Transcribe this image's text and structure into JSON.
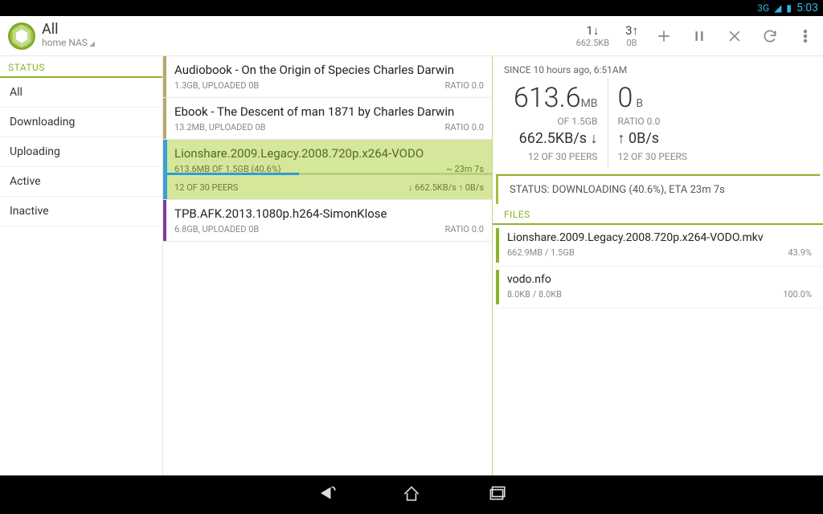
{
  "status_bar": {
    "network": "3G",
    "time": "5:03"
  },
  "header": {
    "title": "All",
    "subtitle": "home NAS",
    "down_count": "1↓",
    "down_rate": "662.5KB",
    "up_count": "3↑",
    "up_rate": "0B"
  },
  "sidebar": {
    "heading": "STATUS",
    "items": [
      "All",
      "Downloading",
      "Uploading",
      "Active",
      "Inactive"
    ]
  },
  "torrents": [
    {
      "name": "Audiobook - On the Origin of Species  Charles Darwin",
      "meta": "1.3GB, UPLOADED 0B",
      "ratio": "RATIO 0.0",
      "color": "#b9a96a",
      "selected": false
    },
    {
      "name": "Ebook - The Descent of man 1871 by Charles Darwin",
      "meta": "13.2MB, UPLOADED 0B",
      "ratio": "RATIO 0.0",
      "color": "#b9a96a",
      "selected": false
    },
    {
      "name": "Lionshare.2009.Legacy.2008.720p.x264-VODO",
      "meta": "613.6MB OF 1.5GB (40.6%)",
      "ratio": "~ 23m 7s",
      "color": "#3aa0d8",
      "selected": true,
      "progress_pct": 40.6,
      "peers": "12 OF 30 PEERS",
      "rates": "↓ 662.5KB/s ↑ 0B/s"
    },
    {
      "name": "TPB.AFK.2013.1080p.h264-SimonKlose",
      "meta": "6.8GB, UPLOADED 0B",
      "ratio": "RATIO 0.0",
      "color": "#7b3fa0",
      "selected": false
    }
  ],
  "detail": {
    "since": "SINCE 10 hours ago, 6:51AM",
    "dl_val": "613.6",
    "dl_unit": "MB",
    "dl_of": "OF 1.5GB",
    "dl_rate": "662.5KB/s ↓",
    "dl_peers": "12 OF 30 PEERS",
    "ul_val": "0",
    "ul_unit": "B",
    "ul_ratio": "RATIO 0.0",
    "ul_rate": "↑ 0B/s",
    "ul_peers": "12 OF 30 PEERS",
    "status_line": "STATUS: DOWNLOADING (40.6%), ETA 23m 7s",
    "files_heading": "FILES",
    "files": [
      {
        "name": "Lionshare.2009.Legacy.2008.720p.x264-VODO.mkv",
        "size": "662.9MB / 1.5GB",
        "pct": "43.9%"
      },
      {
        "name": "vodo.nfo",
        "size": "8.0KB / 8.0KB",
        "pct": "100.0%"
      }
    ]
  }
}
